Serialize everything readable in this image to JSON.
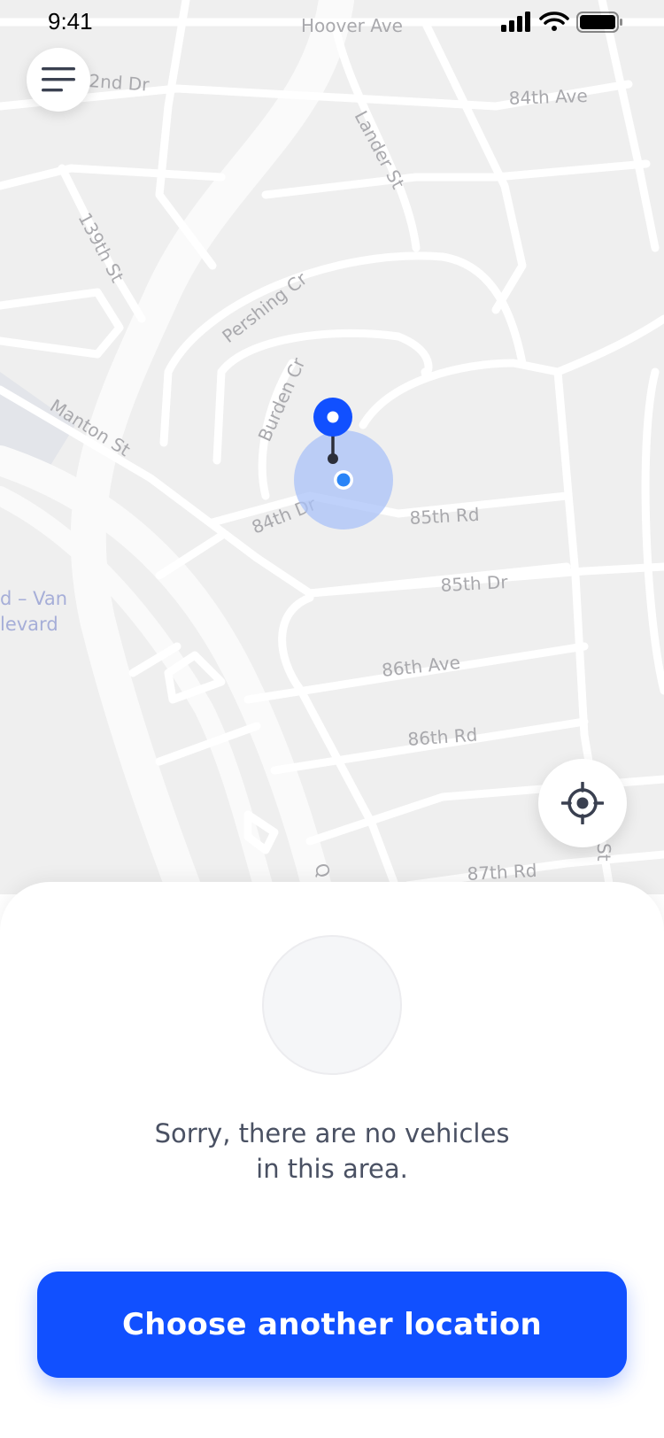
{
  "status_bar": {
    "time": "9:41",
    "icons": [
      "cellular-signal-icon",
      "wifi-icon",
      "battery-icon"
    ]
  },
  "map": {
    "streets": [
      "Hoover Ave",
      "2nd Dr",
      "84th Ave",
      "Lander St",
      "139th St",
      "Pershing Cr",
      "Burden Cr",
      "Manton St",
      "84th Dr",
      "85th Rd",
      "85th Dr",
      "86th Ave",
      "86th Rd",
      "87th Rd",
      "Q",
      "St"
    ],
    "area_label_lines": [
      "d – Van",
      "levard"
    ],
    "pin_icon": "map-pin-icon",
    "current_location_icon": "current-location-dot-icon"
  },
  "controls": {
    "menu_icon": "hamburger-menu-icon",
    "locate_icon": "crosshair-locate-icon"
  },
  "sheet": {
    "message_line1": "Sorry, there are no vehicles",
    "message_line2": "in this area.",
    "button_label": "Choose another location"
  },
  "colors": {
    "accent": "#1150ff",
    "map_background": "#efefef",
    "road": "#ffffff",
    "text_primary": "#4a5163"
  }
}
